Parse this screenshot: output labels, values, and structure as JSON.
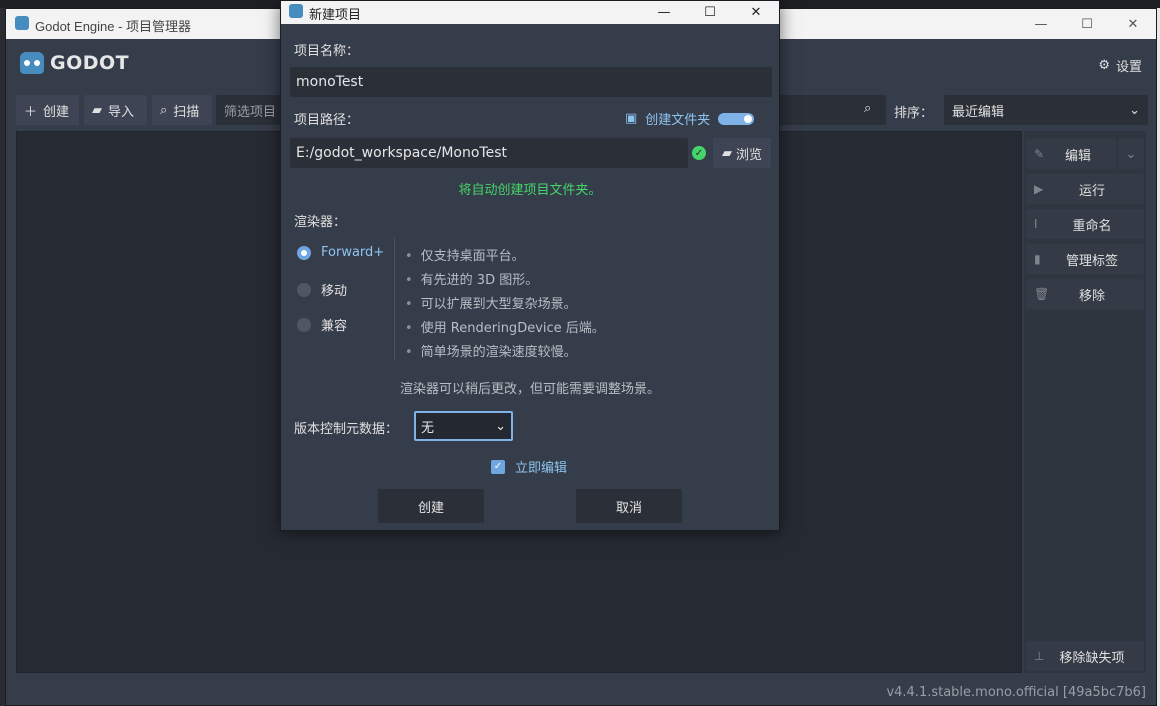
{
  "main_window": {
    "title": "Godot Engine - 项目管理器",
    "logo_text": "GODOT",
    "settings_label": "设置",
    "version": "v4.4.1.stable.mono.official [49a5bc7b6]"
  },
  "toolbar": {
    "create_label": "创建",
    "import_label": "导入",
    "scan_label": "扫描",
    "filter_placeholder": "筛选项目",
    "sort_label": "排序：",
    "sort_value": "最近编辑"
  },
  "side_panel": {
    "edit": "编辑",
    "run": "运行",
    "rename": "重命名",
    "manage_tags": "管理标签",
    "remove": "移除",
    "remove_missing": "移除缺失项"
  },
  "dialog": {
    "title": "新建项目",
    "project_name_label": "项目名称：",
    "project_name_value": "monoTest",
    "project_path_label": "项目路径：",
    "create_folder_label": "创建文件夹",
    "project_path_value": "E:/godot_workspace/MonoTest",
    "browse_label": "浏览",
    "auto_folder_msg": "将自动创建项目文件夹。",
    "renderer_label": "渲染器：",
    "renderers": [
      "Forward+",
      "移动",
      "兼容"
    ],
    "selected_renderer": "Forward+",
    "features": [
      "仅支持桌面平台。",
      "有先进的 3D 图形。",
      "可以扩展到大型复杂场景。",
      "使用 RenderingDevice 后端。",
      "简单场景的渲染速度较慢。"
    ],
    "renderer_note": "渲染器可以稍后更改，但可能需要调整场景。",
    "vcs_label": "版本控制元数据：",
    "vcs_value": "无",
    "edit_now_label": "立即编辑",
    "edit_now_checked": true,
    "create_button": "创建",
    "cancel_button": "取消"
  },
  "colors": {
    "accent": "#6fa6e0",
    "success": "#45d46b",
    "panel_bg": "#363d4a"
  }
}
